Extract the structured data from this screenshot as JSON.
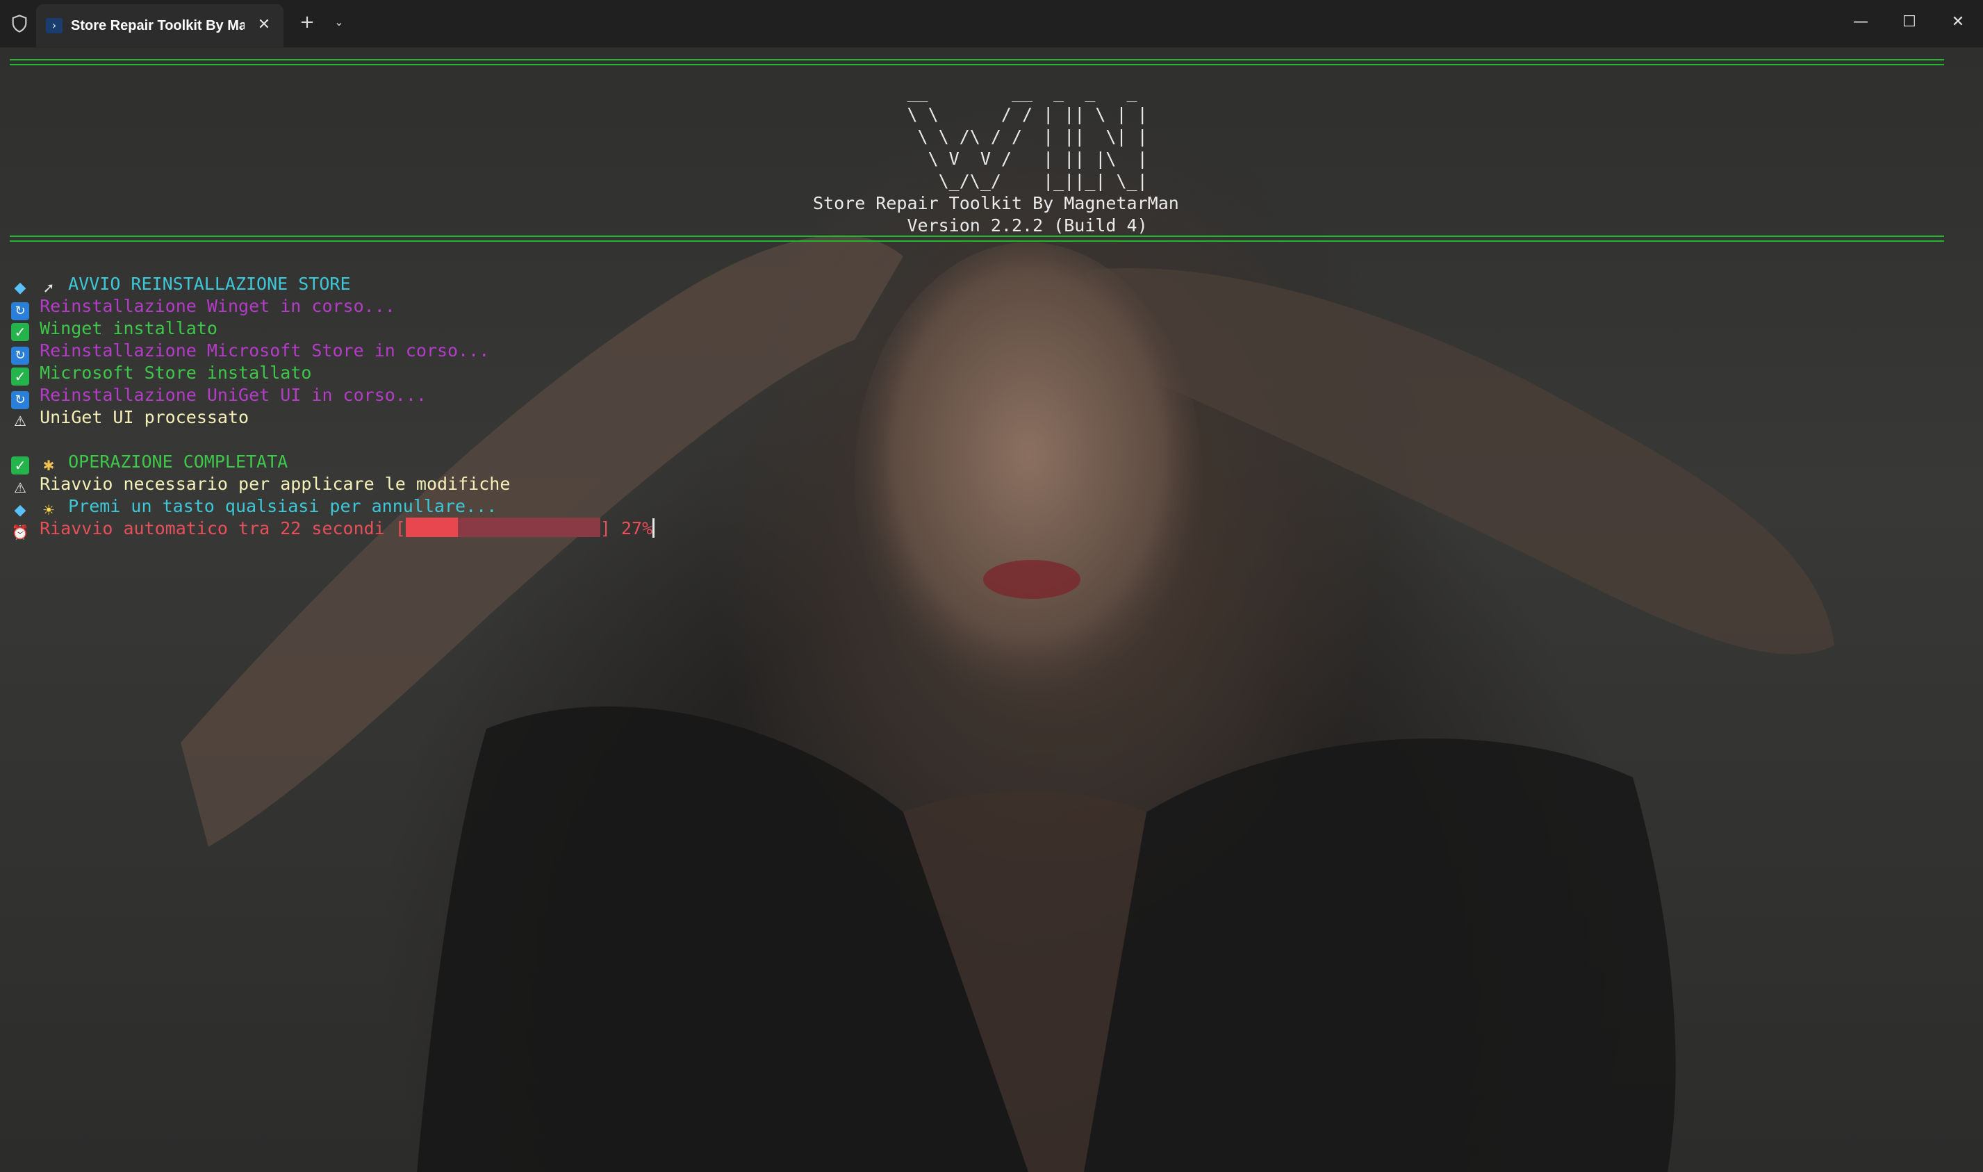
{
  "window": {
    "tab_title": "Store Repair Toolkit By Magne",
    "tab_icon": "powershell-icon",
    "tab_close_glyph": "✕",
    "new_tab_glyph": "+",
    "dropdown_glyph": "⌄",
    "minimize_glyph": "—",
    "maximize_glyph": "☐",
    "close_glyph": "✕"
  },
  "terminal": {
    "rule_color": "#22b82e",
    "ascii_art": [
      "__          __  _  _   _",
      "\\ \\        / / | || \\ | |",
      " \\ \\  /\\  / /  | ||  \\| |",
      "  \\ \\/  \\/ /   | || . ` |",
      "   \\  /\\  /    | || |\\  |",
      "    \\/  \\/     |_||_| \\_|"
    ],
    "banner_ascii": "         __        __  _  _   _\n         \\ \\      / / | || \\ | |\n          \\ \\ /\\ / /  | ||  \\| |\n           \\ V  V /   | || |\\  |\n            \\_/\\_/    |_||_| \\_|\nStore Repair Toolkit By MagnetarMan\n         Version 2.2.2 (Build 4)",
    "lines": [
      {
        "icon": "diamond-icon",
        "icon2": "rocket-icon",
        "text": "AVVIO REINSTALLAZIONE STORE",
        "color": "#3cc8d8"
      },
      {
        "icon": "sync-icon",
        "text": "Reinstallazione Winget in corso...",
        "color": "#b43cc8"
      },
      {
        "icon": "check-icon",
        "text": "Winget installato",
        "color": "#3ec84a"
      },
      {
        "icon": "sync-icon",
        "text": "Reinstallazione Microsoft Store in corso...",
        "color": "#b43cc8"
      },
      {
        "icon": "check-icon",
        "text": "Microsoft Store installato",
        "color": "#3ec84a"
      },
      {
        "icon": "sync-icon",
        "text": "Reinstallazione UniGet UI in corso...",
        "color": "#b43cc8"
      },
      {
        "icon": "warning-icon",
        "text": "UniGet UI processato",
        "color": "#f5efb8"
      },
      {
        "icon": "check-icon",
        "icon2": "party-icon",
        "text": "OPERAZIONE COMPLETATA",
        "color": "#3ec84a"
      },
      {
        "icon": "warning-icon",
        "text": "Riavvio necessario per applicare le modifiche",
        "color": "#f5efb8"
      },
      {
        "icon": "diamond-icon",
        "icon2": "bulb-icon",
        "text": "Premi un tasto qualsiasi per annullare...",
        "color": "#3cc8d8"
      }
    ],
    "restart": {
      "icon": "alarm-icon",
      "prefix": "Riavvio automatico tra 22 secondi [",
      "suffix": "] 27%",
      "progress": 0.27,
      "color": "#e6505a"
    }
  }
}
